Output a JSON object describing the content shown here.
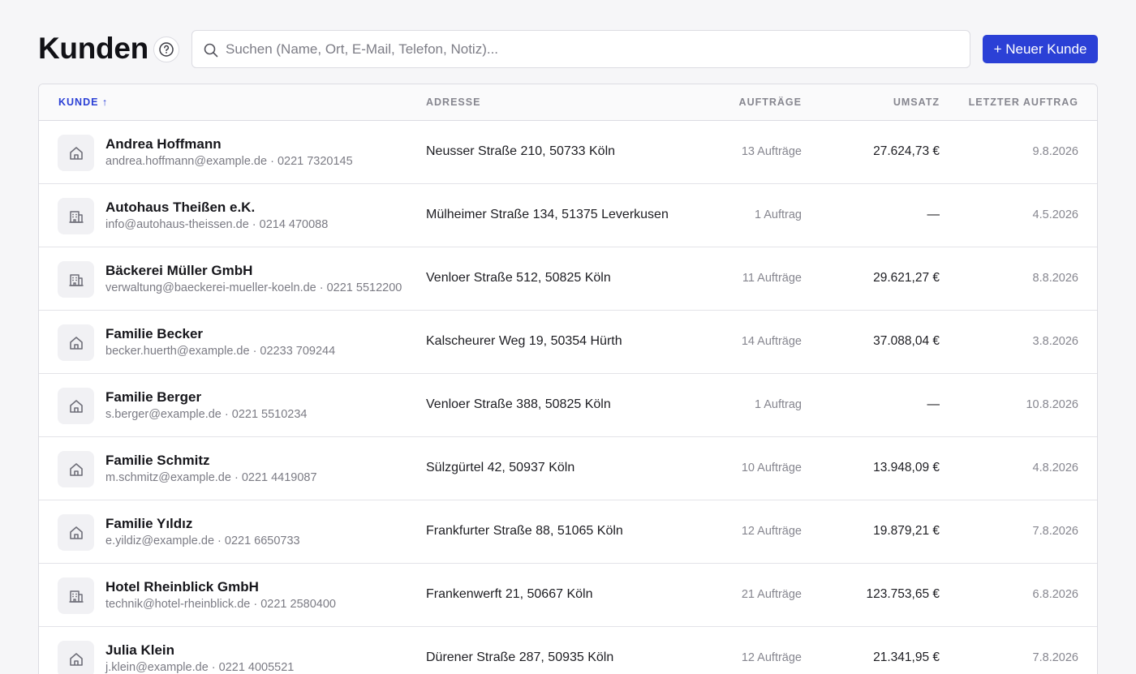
{
  "header": {
    "title": "Kunden",
    "search_placeholder": "Suchen (Name, Ort, E-Mail, Telefon, Notiz)...",
    "new_button": "+ Neuer Kunde"
  },
  "colors": {
    "accent": "#2b40d6",
    "background": "#f6f6f8"
  },
  "table": {
    "columns": {
      "kunde": "KUNDE ↑",
      "adresse": "ADRESSE",
      "auftraege": "AUFTRÄGE",
      "umsatz": "UMSATZ",
      "letzter": "LETZTER AUFTRAG"
    },
    "sort": {
      "column": "kunde",
      "direction": "ascending"
    },
    "rows": [
      {
        "icon": "house-icon",
        "name": "Andrea Hoffmann",
        "contact": "andrea.hoffmann@example.de · 0221 7320145",
        "address": "Neusser Straße 210, 50733 Köln",
        "orders": "13 Aufträge",
        "revenue": "27.624,73 €",
        "last": "9.8.2026"
      },
      {
        "icon": "building-icon",
        "name": "Autohaus Theißen e.K.",
        "contact": "info@autohaus-theissen.de · 0214 470088",
        "address": "Mülheimer Straße 134, 51375 Leverkusen",
        "orders": "1 Auftrag",
        "revenue": "—",
        "last": "4.5.2026"
      },
      {
        "icon": "building-icon",
        "name": "Bäckerei Müller GmbH",
        "contact": "verwaltung@baeckerei-mueller-koeln.de · 0221 5512200",
        "address": "Venloer Straße 512, 50825 Köln",
        "orders": "11 Aufträge",
        "revenue": "29.621,27 €",
        "last": "8.8.2026"
      },
      {
        "icon": "house-icon",
        "name": "Familie Becker",
        "contact": "becker.huerth@example.de · 02233 709244",
        "address": "Kalscheurer Weg 19, 50354 Hürth",
        "orders": "14 Aufträge",
        "revenue": "37.088,04 €",
        "last": "3.8.2026"
      },
      {
        "icon": "house-icon",
        "name": "Familie Berger",
        "contact": "s.berger@example.de · 0221 5510234",
        "address": "Venloer Straße 388, 50825 Köln",
        "orders": "1 Auftrag",
        "revenue": "—",
        "last": "10.8.2026"
      },
      {
        "icon": "house-icon",
        "name": "Familie Schmitz",
        "contact": "m.schmitz@example.de · 0221 4419087",
        "address": "Sülzgürtel 42, 50937 Köln",
        "orders": "10 Aufträge",
        "revenue": "13.948,09 €",
        "last": "4.8.2026"
      },
      {
        "icon": "house-icon",
        "name": "Familie Yıldız",
        "contact": "e.yildiz@example.de · 0221 6650733",
        "address": "Frankfurter Straße 88, 51065 Köln",
        "orders": "12 Aufträge",
        "revenue": "19.879,21 €",
        "last": "7.8.2026"
      },
      {
        "icon": "building-icon",
        "name": "Hotel Rheinblick GmbH",
        "contact": "technik@hotel-rheinblick.de · 0221 2580400",
        "address": "Frankenwerft 21, 50667 Köln",
        "orders": "21 Aufträge",
        "revenue": "123.753,65 €",
        "last": "6.8.2026"
      },
      {
        "icon": "house-icon",
        "name": "Julia Klein",
        "contact": "j.klein@example.de · 0221 4005521",
        "address": "Dürener Straße 287, 50935 Köln",
        "orders": "12 Aufträge",
        "revenue": "21.341,95 €",
        "last": "7.8.2026"
      }
    ]
  }
}
